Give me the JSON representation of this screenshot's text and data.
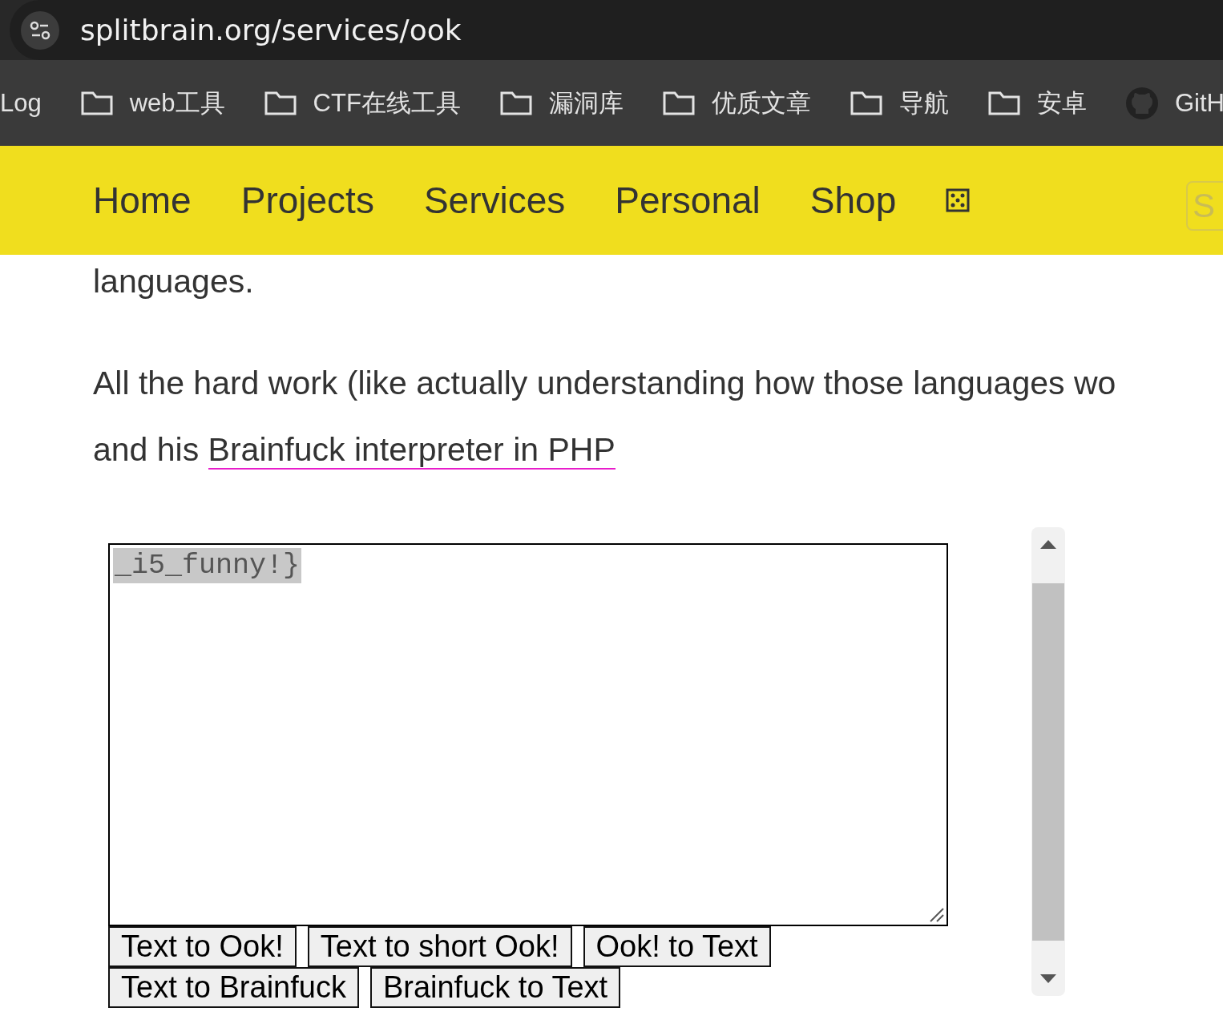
{
  "address_bar": {
    "url": "splitbrain.org/services/ook"
  },
  "bookmarks": [
    {
      "kind": "plain",
      "label": "Log"
    },
    {
      "kind": "folder",
      "label": "web工具"
    },
    {
      "kind": "folder",
      "label": "CTF在线工具"
    },
    {
      "kind": "folder",
      "label": "漏洞库"
    },
    {
      "kind": "folder",
      "label": "优质文章"
    },
    {
      "kind": "folder",
      "label": "导航"
    },
    {
      "kind": "folder",
      "label": "安卓"
    },
    {
      "kind": "github",
      "label": "GitH"
    }
  ],
  "nav": {
    "items": [
      "Home",
      "Projects",
      "Services",
      "Personal",
      "Shop"
    ],
    "search": {
      "placeholder": "S"
    }
  },
  "content": {
    "paragraphs": [
      {
        "text": "languages."
      },
      {
        "text": "All the hard work (like actually understanding how those languages wo",
        "link_line_prefix": "and his ",
        "link": "Brainfuck interpreter in PHP"
      }
    ]
  },
  "tool": {
    "value": "_i5_funny!}",
    "value_selected": true,
    "button_rows": [
      [
        "Text to Ook!",
        "Text to short Ook!",
        "Ook! to Text"
      ],
      [
        "Text to Brainfuck",
        "Brainfuck to Text"
      ]
    ]
  }
}
